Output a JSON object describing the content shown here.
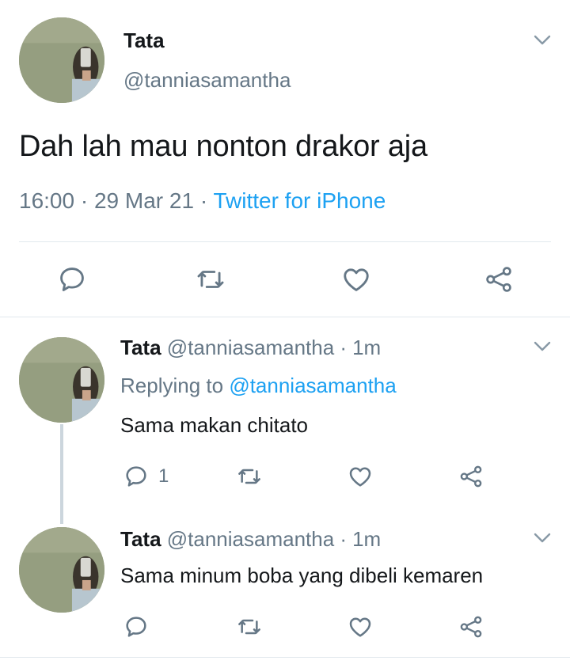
{
  "main_tweet": {
    "name": "Tata",
    "handle": "@tanniasamantha",
    "text": "Dah lah mau nonton drakor aja",
    "time": "16:00",
    "separator": "·",
    "date": "29 Mar 21",
    "source": "Twitter for iPhone"
  },
  "replies": [
    {
      "name": "Tata",
      "handle": "@tanniasamantha",
      "dot": "·",
      "time": "1m",
      "replying_prefix": "Replying to",
      "replying_to": "@tanniasamantha",
      "text": "Sama makan chitato",
      "reply_count": "1"
    },
    {
      "name": "Tata",
      "handle": "@tanniasamantha",
      "dot": "·",
      "time": "1m",
      "text": "Sama minum boba yang dibeli kemaren"
    }
  ],
  "icons": {
    "reply": "reply-icon",
    "retweet": "retweet-icon",
    "like": "heart-icon",
    "share": "share-icon",
    "more": "chevron-down-icon"
  },
  "colors": {
    "accent": "#1da1f2",
    "secondary_text": "#657786",
    "icon": "#657786",
    "divider": "#e1e8ed",
    "thread_line": "#ccd6dd"
  }
}
